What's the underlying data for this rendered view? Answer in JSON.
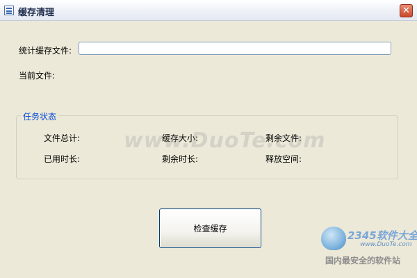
{
  "window": {
    "title": "缓存清理",
    "close_symbol": "✕"
  },
  "form": {
    "stat_label": "统计缓存文件:",
    "stat_value": "",
    "current_file_label": "当前文件:"
  },
  "task_status": {
    "title": "任务状态",
    "file_total_label": "文件总计:",
    "cache_size_label": "缓存大小:",
    "remaining_files_label": "剩余文件:",
    "elapsed_label": "已用时长:",
    "remaining_time_label": "剩余时长:",
    "freed_space_label": "释放空间:"
  },
  "actions": {
    "check_cache_label": "检查缓存"
  },
  "watermark": {
    "text": "www.DuoTe.com"
  },
  "logo": {
    "brand": "2345软件大全",
    "url": "www.DuoTe.com",
    "slogan": "国内最安全的软件站"
  },
  "colors": {
    "window_bg": "#ece9d8",
    "group_title": "#0046d5",
    "close_button": "#c94a2c"
  },
  "icons": {
    "app": "window-app-icon",
    "close": "close-icon"
  }
}
